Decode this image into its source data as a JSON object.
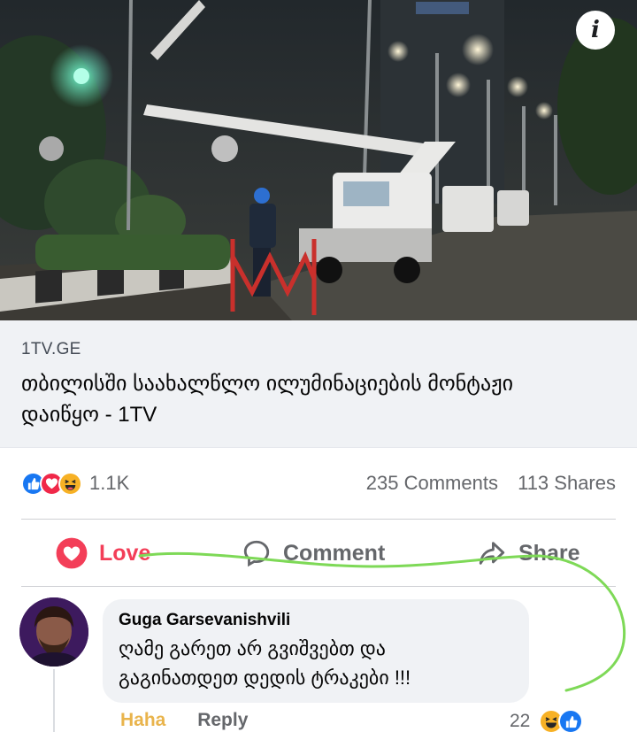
{
  "post": {
    "info_icon": "info-icon",
    "photo_icon": "street-scene-photo"
  },
  "link": {
    "domain": "1TV.GE",
    "title": "თბილისში საახალწლო ილუმინაციების მონტაჟი დაიწყო - 1TV"
  },
  "stats": {
    "reaction_icons": [
      "like-icon",
      "love-icon",
      "haha-icon"
    ],
    "reaction_count": "1.1K",
    "comments": "235 Comments",
    "shares": "113 Shares"
  },
  "actions": {
    "love": "Love",
    "comment": "Comment",
    "share": "Share"
  },
  "comment": {
    "author": "Guga Garsevanishvili",
    "text_line1": "ღამე გარეთ არ გვიშვებთ და",
    "text_line2": "გაგინათდეთ დედის ტრაკები !!!",
    "haha": "Haha",
    "reply": "Reply",
    "reaction_count": "22"
  },
  "colors": {
    "love": "#f33e58",
    "like": "#1877f2",
    "haha": "#f7b125",
    "scribble": "#7ed957"
  }
}
